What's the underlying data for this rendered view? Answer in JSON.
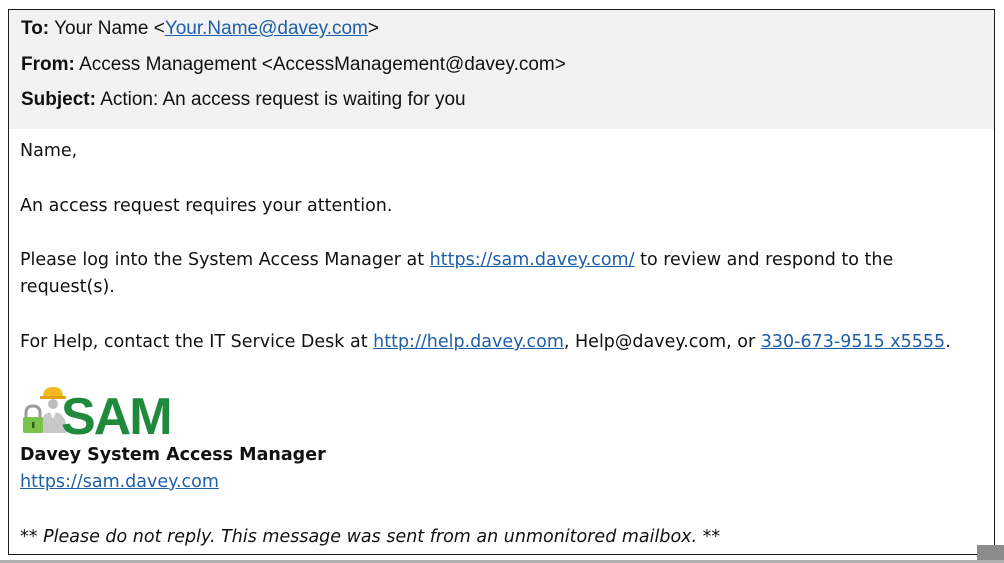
{
  "header": {
    "to_label": "To:",
    "to_name": "Your Name <",
    "to_email": "Your.Name@davey.com",
    "to_close": ">",
    "from_label": "From:",
    "from_value": "Access Management <AccessManagement@davey.com>",
    "subject_label": "Subject:",
    "subject_value": "Action: An access request is waiting for you"
  },
  "body": {
    "greeting": "Name,",
    "attention": "An access request requires your attention.",
    "login_pre": "Please log into the System Access Manager at ",
    "login_link": "https://sam.davey.com/",
    "login_post": " to review and respond to the",
    "login_line2": "request(s).",
    "help_pre": "For Help, contact the IT Service Desk at ",
    "help_link": "http://help.davey.com",
    "help_mid": ", Help@davey.com, or ",
    "help_phone": "330-673-9515 x5555",
    "help_end": ".",
    "logo_text": "SAM",
    "signature": "Davey System Access Manager",
    "signature_url": "https://sam.davey.com",
    "noreply": "** Please do not reply.  This message was sent from an unmonitored mailbox. **"
  },
  "colors": {
    "link": "#1f5fa8",
    "logo_green": "#1f8a3c",
    "logo_yellow": "#f5b820",
    "header_bg": "#f2f2f2"
  }
}
